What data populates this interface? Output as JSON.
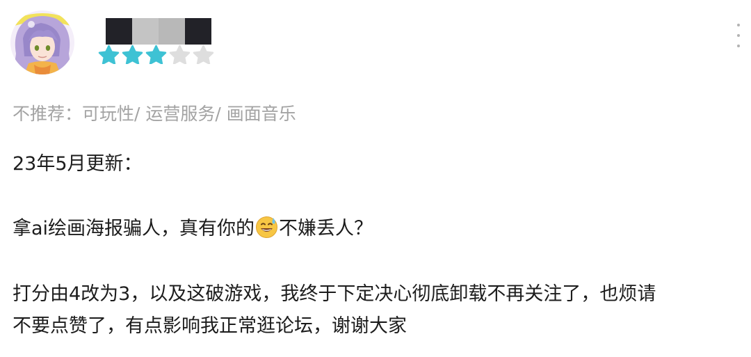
{
  "review": {
    "rating": {
      "filled": 3,
      "total": 5,
      "filled_color": "#3ec2d4",
      "empty_color": "#dedede"
    },
    "not_recommended_label": "不推荐：",
    "not_recommended_items": "可玩性/ 运营服务/ 画面音乐",
    "update_heading": "23年5月更新：",
    "line1_before": "拿ai绘画海报骗人，真有你的",
    "line1_emoji": "sweat-smile-emoji",
    "line1_after": "不嫌丢人？",
    "line2": "打分由4改为3，以及这破游戏，我终于下定决心彻底卸载不再关注了，也烦请",
    "line3": "不要点赞了，有点影响我正常逛论坛，谢谢大家"
  },
  "colors": {
    "text": "#1c1c1c",
    "muted": "#a3a3a3",
    "redact_dark": "#222228",
    "redact_gray": "#c4c4c4"
  }
}
